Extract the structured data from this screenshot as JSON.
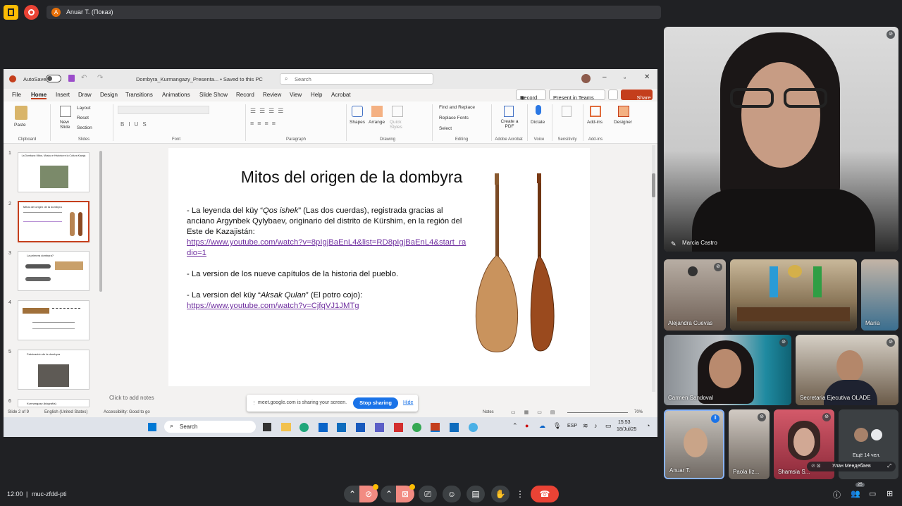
{
  "meet": {
    "presenter_label": "Anuar T. (Показ)",
    "presenter_initial": "A",
    "time": "12:00",
    "meeting_code": "muc-zfdd-pti",
    "participant_count_badge": "25",
    "more_participants": "Ещё 14 чел.",
    "sharing_msg": "meet.google.com is sharing your screen.",
    "stop_sharing": "Stop sharing",
    "hide": "Hide"
  },
  "participants": [
    {
      "name": "Marcia Castro",
      "pinned": true
    },
    {
      "name": "Alejandra Cuevas"
    },
    {
      "name": ""
    },
    {
      "name": "María"
    },
    {
      "name": "Carmen Sandoval"
    },
    {
      "name": "Secretaria Ejecutiva OLADE"
    },
    {
      "name": "Anuar T."
    },
    {
      "name": "Paola Iiz..."
    },
    {
      "name": "Shamsia S..."
    },
    {
      "name": "Улан Мендебаев"
    }
  ],
  "ppt": {
    "autosave": "AutoSave",
    "file_title": "Dombyra_Kurmangazy_Presenta... • Saved to this PC",
    "search": "Search",
    "tabs": [
      "File",
      "Home",
      "Insert",
      "Draw",
      "Design",
      "Transitions",
      "Animations",
      "Slide Show",
      "Record",
      "Review",
      "View",
      "Help",
      "Acrobat"
    ],
    "record_btn": "Record",
    "present_teams": "Present in Teams",
    "share_btn": "Share",
    "ribbon": {
      "paste": "Paste",
      "clipboard": "Clipboard",
      "new_slide": "New Slide",
      "layout": "Layout",
      "reset": "Reset",
      "section": "Section",
      "slides": "Slides",
      "font": "Font",
      "paragraph": "Paragraph",
      "shapes": "Shapes",
      "arrange": "Arrange",
      "quick_styles": "Quick Styles",
      "drawing": "Drawing",
      "find_replace": "Find and Replace",
      "replace_fonts": "Replace Fonts",
      "select": "Select",
      "editing": "Editing",
      "create_pdf": "Create a PDF",
      "adobe": "Adobe Acrobat",
      "dictate": "Dictate",
      "voice": "Voice",
      "sensitivity": "Sensitivity",
      "addins": "Add-ins",
      "designer": "Designer"
    },
    "thumbnails": [
      {
        "num": "1",
        "title": "La Dombyra: Mitos, Música e Historia en la Cultura Kazaja"
      },
      {
        "num": "2",
        "title": "Mitos del origen de la dombyra"
      },
      {
        "num": "3",
        "title": "La primera dombyra?"
      },
      {
        "num": "4",
        "title": ""
      },
      {
        "num": "5",
        "title": "Fabricación de la dombyra"
      },
      {
        "num": "6",
        "title": "Kurmangazy (biografía)"
      }
    ],
    "slide": {
      "title": "Mitos del origen de la dombyra",
      "b1_a": " - La leyenda del küy “",
      "b1_i": "Qos ishek",
      "b1_b": "” (Las dos cuerdas), registrada gracias al anciano Argynbek Qylybaev, originario del distrito de Kürshim, en la región del Este de Kazajistán:",
      "b1_link": "https://www.youtube.com/watch?v=8pIgjBaEnL4&list=RD8pIgjBaEnL4&start_radio=1",
      "b2": " - La version de los nueve capítulos de la historia del pueblo.",
      "b3_a": " - La version del küy “",
      "b3_i": "Aksak Qulan",
      "b3_b": "” (El potro cojo):",
      "b3_link": "https://www.youtube.com/watch?v=CjfqVJ1JMTg"
    },
    "notes_placeholder": "Click to add notes",
    "status": {
      "slide_of": "Slide 2 of 9",
      "language": "English (United States)",
      "accessibility": "Accessibility: Good to go",
      "notes": "Notes",
      "zoom": "70%"
    },
    "taskbar": {
      "search": "Search",
      "clock_time": "15:53",
      "clock_date": "18/Jul/25",
      "lang": "ESP"
    }
  },
  "colors": {
    "ppt_accent": "#c43e1c",
    "link": "#7030a0",
    "meet_blue": "#1a73e8",
    "end_call": "#ea4335"
  }
}
